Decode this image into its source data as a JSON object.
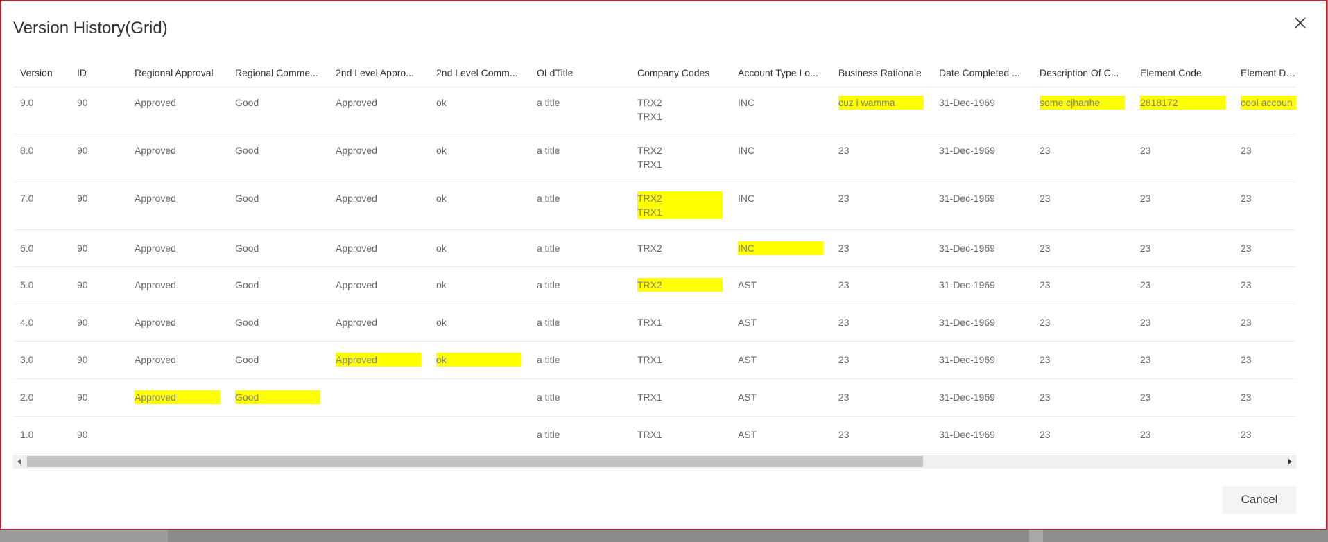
{
  "dialog": {
    "title": "Version History(Grid)",
    "cancel_label": "Cancel",
    "close_icon": "close-icon"
  },
  "colors": {
    "highlight": "#ffff00",
    "border": "#e81123"
  },
  "grid": {
    "columns": [
      "Version",
      "ID",
      "Regional Approval",
      "Regional Comme...",
      "2nd Level Appro...",
      "2nd Level Comm...",
      "OLdTitle",
      "Company Codes",
      "Account Type Lo...",
      "Business Rationale",
      "Date Completed ...",
      "Description Of C...",
      "Element Code",
      "Element Des"
    ],
    "rows": [
      {
        "cells": [
          "9.0",
          "90",
          "Approved",
          "Good",
          "Approved",
          "ok",
          "a title",
          "TRX2\nTRX1",
          "INC",
          "cuz i wamma",
          "31-Dec-1969",
          "some cjhanhe",
          "2818172",
          "cool accoun"
        ],
        "highlight": [
          9,
          11,
          12,
          13
        ]
      },
      {
        "cells": [
          "8.0",
          "90",
          "Approved",
          "Good",
          "Approved",
          "ok",
          "a title",
          "TRX2\nTRX1",
          "INC",
          "23",
          "31-Dec-1969",
          "23",
          "23",
          "23"
        ],
        "highlight": []
      },
      {
        "cells": [
          "7.0",
          "90",
          "Approved",
          "Good",
          "Approved",
          "ok",
          "a title",
          "TRX2\nTRX1",
          "INC",
          "23",
          "31-Dec-1969",
          "23",
          "23",
          "23"
        ],
        "highlight": [
          7
        ]
      },
      {
        "cells": [
          "6.0",
          "90",
          "Approved",
          "Good",
          "Approved",
          "ok",
          "a title",
          "TRX2",
          "INC",
          "23",
          "31-Dec-1969",
          "23",
          "23",
          "23"
        ],
        "highlight": [
          8
        ]
      },
      {
        "cells": [
          "5.0",
          "90",
          "Approved",
          "Good",
          "Approved",
          "ok",
          "a title",
          "TRX2",
          "AST",
          "23",
          "31-Dec-1969",
          "23",
          "23",
          "23"
        ],
        "highlight": [
          7
        ]
      },
      {
        "cells": [
          "4.0",
          "90",
          "Approved",
          "Good",
          "Approved",
          "ok",
          "a title",
          "TRX1",
          "AST",
          "23",
          "31-Dec-1969",
          "23",
          "23",
          "23"
        ],
        "highlight": []
      },
      {
        "cells": [
          "3.0",
          "90",
          "Approved",
          "Good",
          "Approved",
          "ok",
          "a title",
          "TRX1",
          "AST",
          "23",
          "31-Dec-1969",
          "23",
          "23",
          "23"
        ],
        "highlight": [
          4,
          5
        ]
      },
      {
        "cells": [
          "2.0",
          "90",
          "Approved",
          "Good",
          "",
          "",
          "a title",
          "TRX1",
          "AST",
          "23",
          "31-Dec-1969",
          "23",
          "23",
          "23"
        ],
        "highlight": [
          2,
          3
        ]
      },
      {
        "cells": [
          "1.0",
          "90",
          "",
          "",
          "",
          "",
          "a title",
          "TRX1",
          "AST",
          "23",
          "31-Dec-1969",
          "23",
          "23",
          "23"
        ],
        "highlight": []
      }
    ]
  }
}
